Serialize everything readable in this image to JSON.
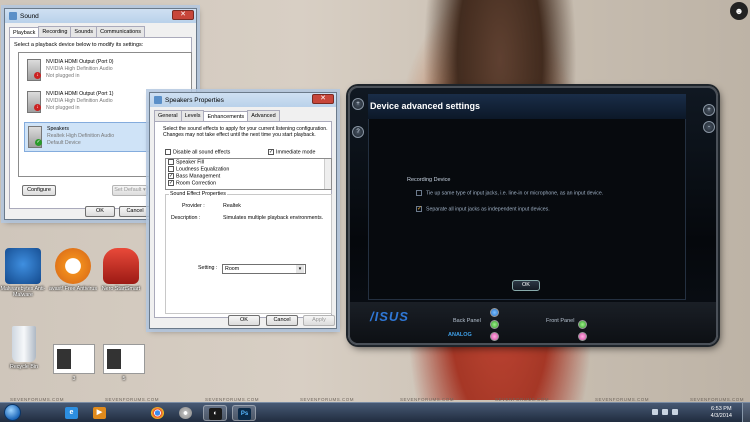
{
  "sound_dialog": {
    "title": "Sound",
    "tabs": [
      "Playback",
      "Recording",
      "Sounds",
      "Communications"
    ],
    "instruction": "Select a playback device below to modify its settings:",
    "devices": [
      {
        "name": "NVIDIA HDMI Output (Port 0)",
        "driver": "NVIDIA High Definition Audio",
        "status": "Not plugged in"
      },
      {
        "name": "NVIDIA HDMI Output (Port 1)",
        "driver": "NVIDIA High Definition Audio",
        "status": "Not plugged in"
      },
      {
        "name": "Speakers",
        "driver": "Realtek High Definition Audio",
        "status": "Default Device"
      }
    ],
    "configure_label": "Configure",
    "set_default_label": "Set Default",
    "ok_label": "OK",
    "cancel_label": "Cancel"
  },
  "speakers_dialog": {
    "title": "Speakers Properties",
    "tabs": [
      "General",
      "Levels",
      "Enhancements",
      "Advanced"
    ],
    "instruction": "Select the sound effects to apply for your current listening configuration. Changes may not take effect until the next time you start playback.",
    "disable_all_label": "Disable all sound effects",
    "immediate_mode_label": "Immediate mode",
    "effects": [
      {
        "label": "Speaker Fill",
        "checked": false
      },
      {
        "label": "Loudness Equalization",
        "checked": false
      },
      {
        "label": "Bass Management",
        "checked": true
      },
      {
        "label": "Room Correction",
        "checked": true
      }
    ],
    "properties_group": "Sound Effect Properties",
    "provider_label": "Provider :",
    "provider_value": "Realtek",
    "description_label": "Description :",
    "description_value": "Simulates multiple playback environments.",
    "setting_label": "Setting :",
    "setting_value": "Room",
    "ok_label": "OK",
    "cancel_label": "Cancel",
    "apply_label": "Apply"
  },
  "asus_panel": {
    "title": "Device advanced settings",
    "section": "Recording Device",
    "option1": "Tie up same type of input jacks, i.e. line-in or microphone, as an input device.",
    "option2": "Separate all input jacks as independent input devices.",
    "ok_label": "OK",
    "logo": "/ISUS",
    "back_panel": "Back Panel",
    "front_panel": "Front Panel",
    "analog": "ANALOG",
    "side_buttons": [
      "+",
      "?",
      "-",
      "+"
    ]
  },
  "desktop_icons": [
    {
      "label": "Malwarebytes Anti-Malware"
    },
    {
      "label": "avast! Free Antivirus"
    },
    {
      "label": "Nero StartSmart"
    },
    {
      "label": "Recycle Bin"
    },
    {
      "label": "3"
    },
    {
      "label": "5"
    }
  ],
  "watermarks": [
    "SEVENFORUMS.COM",
    "SEVENFORUMS.COM",
    "SEVENFORUMS.COM",
    "SEVENFORUMS.COM",
    "SEVENFORUMS.COM",
    "SEVENFORUMS.COM",
    "SEVENFORUMS.COM",
    "SEVENFORUMS.COM"
  ],
  "taskbar": {
    "ps_label": "Ps",
    "time": "6:53 PM",
    "date": "4/3/2014"
  },
  "colors": {
    "asus_blue": "#2f77d6",
    "checkmark": "#e7a93a",
    "close_red": "#c7463a"
  }
}
